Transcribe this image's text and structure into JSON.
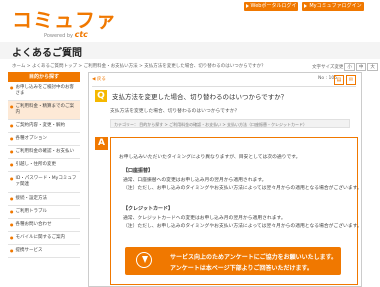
{
  "header": {
    "logo": "コミュファ",
    "logo_sub_prefix": "Powered by",
    "logo_sub_brand": "ctc",
    "web_login": "Webポータルログイン",
    "my_login": "Myコミュファログイン"
  },
  "page": {
    "title": "よくあるご質問",
    "breadcrumb": "ホーム > よくあるご質問トップ > ご利用料金・お支払い方法 > 支払方法を変更した場合、切り替わるのはいつからですか？",
    "font_size_label": "文字サイズ変更",
    "font_sizes": [
      "小",
      "中",
      "大"
    ]
  },
  "sidebar": {
    "heading": "目的から探す",
    "items": [
      {
        "label": "お申し込みをご検討中のお客さま"
      },
      {
        "label": "ご利用料金・精算までのご案内"
      },
      {
        "label": "ご契約内容・変更・解約"
      },
      {
        "label": "各種オプション"
      },
      {
        "label": "ご利用料金の確認・お支払い"
      },
      {
        "label": "引越し・住所の変更"
      },
      {
        "label": "ID・パスワード・Myコミュファ関連"
      },
      {
        "label": "接続・設定方法"
      },
      {
        "label": "ご利用トラブル"
      },
      {
        "label": "各種お問い合わせ"
      },
      {
        "label": "モバイルに関するご案内"
      },
      {
        "label": "提携サービス"
      }
    ]
  },
  "main": {
    "back_label": "戻る",
    "no_label": "No : 105",
    "print_icon": "print-icon",
    "mail_icon": "mail-icon",
    "q_badge": "Q",
    "question_title": "支払方法を変更した場合、切り替わるのはいつからですか？",
    "question_body": "支払方法を変更した場合、切り替わるのはいつからですか？",
    "category": "カテゴリー： 目的から探す > ご利用料金の確認・お支払い > 支払い方法（口座振替・クレジットカード）",
    "a_badge": "A",
    "answer": {
      "intro": "お申し込みいただいたタイミングにより異なりますが、目安としては次の通りです。",
      "bank_head": "【口座振替】",
      "bank_l1": "通常、口座振替への変更はお申し込み月の翌月から適用されます。",
      "bank_l2": "（注）ただし、お申し込みのタイミングやお支払い方法によっては翌々月からの適用となる場合がございます。",
      "card_head": "【クレジットカード】",
      "card_l1": "通常、クレジットカードへの変更はお申し込み月の翌月から適用されます。",
      "card_l2": "（注）ただし、お申し込みのタイミングやお支払い方法によっては翌々月からの適用となる場合がございます。"
    },
    "survey": {
      "line1": "サービス向上のためアンケートにご協力をお願いいたします。",
      "line2": "アンケートは本ページ下部よりご回答いただけます。"
    }
  },
  "colors": {
    "accent": "#f07800",
    "q_badge": "#f5b800"
  }
}
